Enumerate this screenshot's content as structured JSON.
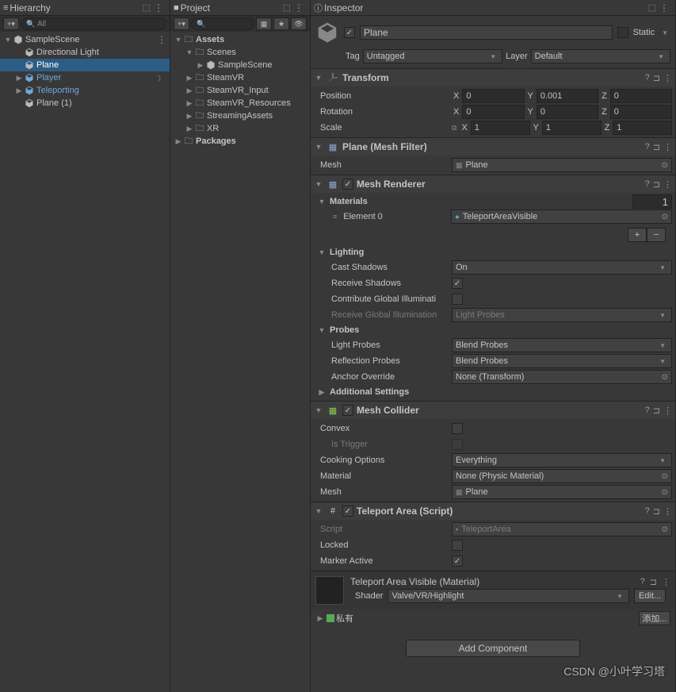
{
  "hierarchy": {
    "title": "Hierarchy",
    "search_placeholder": "All",
    "items": [
      {
        "label": "SampleScene",
        "indent": 0,
        "icon": "scene",
        "arrow": "▼",
        "blue": false,
        "more": true
      },
      {
        "label": "Directional Light",
        "indent": 1,
        "icon": "cube",
        "arrow": "",
        "blue": false
      },
      {
        "label": "Plane",
        "indent": 1,
        "icon": "cube",
        "arrow": "",
        "blue": false,
        "selected": true
      },
      {
        "label": "Player",
        "indent": 1,
        "icon": "cube",
        "arrow": "▶",
        "blue": true,
        "chevron": true
      },
      {
        "label": "Teleporting",
        "indent": 1,
        "icon": "cube",
        "arrow": "▶",
        "blue": true
      },
      {
        "label": "Plane (1)",
        "indent": 1,
        "icon": "cube",
        "arrow": "",
        "blue": false
      }
    ]
  },
  "project": {
    "title": "Project",
    "search_placeholder": "",
    "items": [
      {
        "label": "Assets",
        "indent": 0,
        "arrow": "▼",
        "bold": true
      },
      {
        "label": "Scenes",
        "indent": 1,
        "arrow": "▼"
      },
      {
        "label": "SampleScene",
        "indent": 2,
        "arrow": "▶",
        "icon": "scene"
      },
      {
        "label": "SteamVR",
        "indent": 1,
        "arrow": "▶"
      },
      {
        "label": "SteamVR_Input",
        "indent": 1,
        "arrow": "▶"
      },
      {
        "label": "SteamVR_Resources",
        "indent": 1,
        "arrow": "▶"
      },
      {
        "label": "StreamingAssets",
        "indent": 1,
        "arrow": "▶"
      },
      {
        "label": "XR",
        "indent": 1,
        "arrow": "▶"
      },
      {
        "label": "Packages",
        "indent": 0,
        "arrow": "▶",
        "bold": true
      }
    ]
  },
  "inspector": {
    "title": "Inspector",
    "object_name": "Plane",
    "static_label": "Static",
    "tag_label": "Tag",
    "tag_value": "Untagged",
    "layer_label": "Layer",
    "layer_value": "Default",
    "transform": {
      "title": "Transform",
      "position_label": "Position",
      "px": "0",
      "py": "0.001",
      "pz": "0",
      "rotation_label": "Rotation",
      "rx": "0",
      "ry": "0",
      "rz": "0",
      "scale_label": "Scale",
      "sx": "1",
      "sy": "1",
      "sz": "1"
    },
    "mesh_filter": {
      "title": "Plane (Mesh Filter)",
      "mesh_label": "Mesh",
      "mesh_value": "Plane"
    },
    "mesh_renderer": {
      "title": "Mesh Renderer",
      "materials_label": "Materials",
      "materials_count": "1",
      "element0_label": "Element 0",
      "element0_value": "TeleportAreaVisible",
      "lighting_label": "Lighting",
      "cast_shadows_label": "Cast Shadows",
      "cast_shadows_value": "On",
      "receive_shadows_label": "Receive Shadows",
      "contribute_gi_label": "Contribute Global Illuminati",
      "receive_gi_label": "Receive Global Illumination",
      "receive_gi_value": "Light Probes",
      "probes_label": "Probes",
      "light_probes_label": "Light Probes",
      "light_probes_value": "Blend Probes",
      "reflection_probes_label": "Reflection Probes",
      "reflection_probes_value": "Blend Probes",
      "anchor_label": "Anchor Override",
      "anchor_value": "None (Transform)",
      "additional_label": "Additional Settings"
    },
    "mesh_collider": {
      "title": "Mesh Collider",
      "convex_label": "Convex",
      "is_trigger_label": "Is Trigger",
      "cooking_label": "Cooking Options",
      "cooking_value": "Everything",
      "material_label": "Material",
      "material_value": "None (Physic Material)",
      "mesh_label": "Mesh",
      "mesh_value": "Plane"
    },
    "teleport_area": {
      "title": "Teleport Area (Script)",
      "script_label": "Script",
      "script_value": "TeleportArea",
      "locked_label": "Locked",
      "marker_label": "Marker Active"
    },
    "material": {
      "title": "Teleport Area Visible (Material)",
      "shader_label": "Shader",
      "shader_value": "Valve/VR/Highlight",
      "edit_label": "Edit...",
      "private_label": "私有",
      "add_label": "添加..."
    },
    "add_component": "Add Component"
  },
  "watermark": "CSDN @小叶学习塔"
}
